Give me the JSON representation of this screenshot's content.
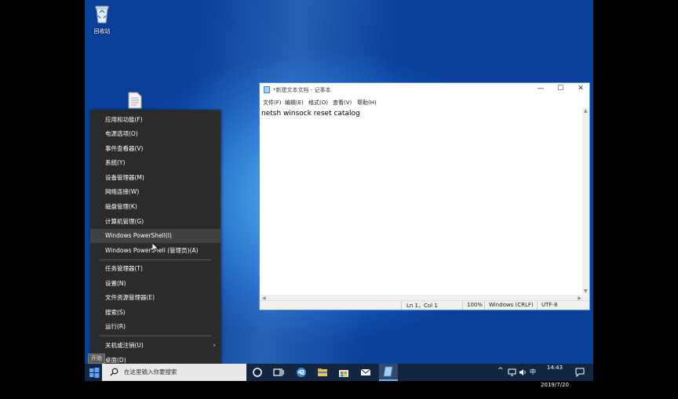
{
  "desktop": {
    "recycle_bin_label": "回收站"
  },
  "context_menu": {
    "items": [
      {
        "label": "应用和功能(F)"
      },
      {
        "label": "电源选项(O)"
      },
      {
        "label": "事件查看器(V)"
      },
      {
        "label": "系统(Y)"
      },
      {
        "label": "设备管理器(M)"
      },
      {
        "label": "网络连接(W)"
      },
      {
        "label": "磁盘管理(K)"
      },
      {
        "label": "计算机管理(G)"
      },
      {
        "label": "Windows PowerShell(I)"
      },
      {
        "label": "Windows PowerShell (管理员)(A)"
      },
      {
        "label": "任务管理器(T)"
      },
      {
        "label": "设置(N)"
      },
      {
        "label": "文件资源管理器(E)"
      },
      {
        "label": "搜索(S)"
      },
      {
        "label": "运行(R)"
      },
      {
        "label": "关机或注销(U)"
      },
      {
        "label": "桌面(D)"
      }
    ],
    "start_tooltip": "开始"
  },
  "notepad": {
    "title": "*新建文本文档 - 记事本",
    "menu": [
      "文件(F)",
      "编辑(E)",
      "格式(O)",
      "查看(V)",
      "帮助(H)"
    ],
    "content": "netsh winsock reset catalog",
    "status": {
      "position": "Ln 1，Col 1",
      "zoom": "100%",
      "line_ending": "Windows (CRLF)",
      "encoding": "UTF-8"
    },
    "controls": {
      "minimize": "—",
      "maximize": "☐",
      "close": "✕"
    }
  },
  "taskbar": {
    "search_placeholder": "在这里输入你要搜索",
    "ime": "中",
    "time": "14:43",
    "date": "2019/7/20"
  },
  "colors": {
    "accent": "#1254b4",
    "menu_bg": "#2b2b2b",
    "taskbar_bg": "#13263f"
  }
}
